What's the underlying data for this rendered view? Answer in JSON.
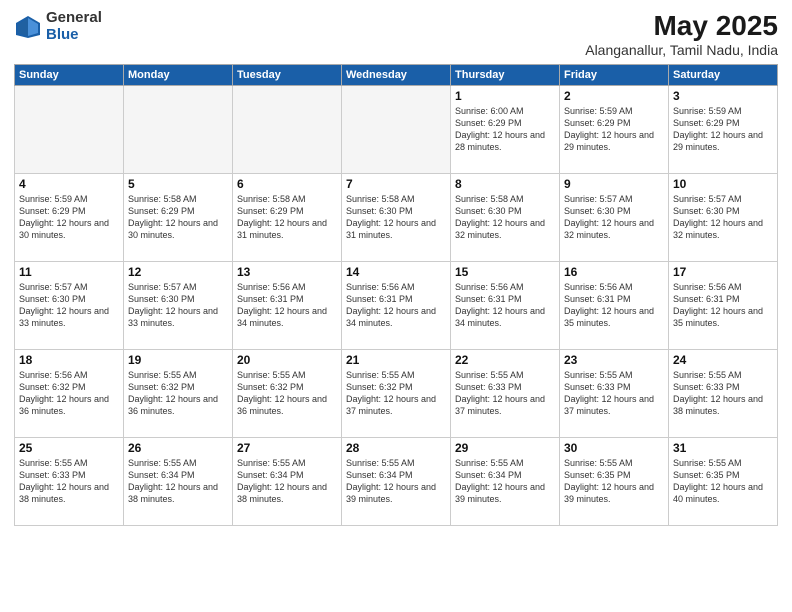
{
  "logo": {
    "general": "General",
    "blue": "Blue"
  },
  "title": "May 2025",
  "subtitle": "Alanganallur, Tamil Nadu, India",
  "days_of_week": [
    "Sunday",
    "Monday",
    "Tuesday",
    "Wednesday",
    "Thursday",
    "Friday",
    "Saturday"
  ],
  "weeks": [
    [
      {
        "day": "",
        "empty": true
      },
      {
        "day": "",
        "empty": true
      },
      {
        "day": "",
        "empty": true
      },
      {
        "day": "",
        "empty": true
      },
      {
        "day": "1",
        "sunrise": "6:00 AM",
        "sunset": "6:29 PM",
        "daylight": "12 hours and 28 minutes."
      },
      {
        "day": "2",
        "sunrise": "5:59 AM",
        "sunset": "6:29 PM",
        "daylight": "12 hours and 29 minutes."
      },
      {
        "day": "3",
        "sunrise": "5:59 AM",
        "sunset": "6:29 PM",
        "daylight": "12 hours and 29 minutes."
      }
    ],
    [
      {
        "day": "4",
        "sunrise": "5:59 AM",
        "sunset": "6:29 PM",
        "daylight": "12 hours and 30 minutes."
      },
      {
        "day": "5",
        "sunrise": "5:58 AM",
        "sunset": "6:29 PM",
        "daylight": "12 hours and 30 minutes."
      },
      {
        "day": "6",
        "sunrise": "5:58 AM",
        "sunset": "6:29 PM",
        "daylight": "12 hours and 31 minutes."
      },
      {
        "day": "7",
        "sunrise": "5:58 AM",
        "sunset": "6:30 PM",
        "daylight": "12 hours and 31 minutes."
      },
      {
        "day": "8",
        "sunrise": "5:58 AM",
        "sunset": "6:30 PM",
        "daylight": "12 hours and 32 minutes."
      },
      {
        "day": "9",
        "sunrise": "5:57 AM",
        "sunset": "6:30 PM",
        "daylight": "12 hours and 32 minutes."
      },
      {
        "day": "10",
        "sunrise": "5:57 AM",
        "sunset": "6:30 PM",
        "daylight": "12 hours and 32 minutes."
      }
    ],
    [
      {
        "day": "11",
        "sunrise": "5:57 AM",
        "sunset": "6:30 PM",
        "daylight": "12 hours and 33 minutes."
      },
      {
        "day": "12",
        "sunrise": "5:57 AM",
        "sunset": "6:30 PM",
        "daylight": "12 hours and 33 minutes."
      },
      {
        "day": "13",
        "sunrise": "5:56 AM",
        "sunset": "6:31 PM",
        "daylight": "12 hours and 34 minutes."
      },
      {
        "day": "14",
        "sunrise": "5:56 AM",
        "sunset": "6:31 PM",
        "daylight": "12 hours and 34 minutes."
      },
      {
        "day": "15",
        "sunrise": "5:56 AM",
        "sunset": "6:31 PM",
        "daylight": "12 hours and 34 minutes."
      },
      {
        "day": "16",
        "sunrise": "5:56 AM",
        "sunset": "6:31 PM",
        "daylight": "12 hours and 35 minutes."
      },
      {
        "day": "17",
        "sunrise": "5:56 AM",
        "sunset": "6:31 PM",
        "daylight": "12 hours and 35 minutes."
      }
    ],
    [
      {
        "day": "18",
        "sunrise": "5:56 AM",
        "sunset": "6:32 PM",
        "daylight": "12 hours and 36 minutes."
      },
      {
        "day": "19",
        "sunrise": "5:55 AM",
        "sunset": "6:32 PM",
        "daylight": "12 hours and 36 minutes."
      },
      {
        "day": "20",
        "sunrise": "5:55 AM",
        "sunset": "6:32 PM",
        "daylight": "12 hours and 36 minutes."
      },
      {
        "day": "21",
        "sunrise": "5:55 AM",
        "sunset": "6:32 PM",
        "daylight": "12 hours and 37 minutes."
      },
      {
        "day": "22",
        "sunrise": "5:55 AM",
        "sunset": "6:33 PM",
        "daylight": "12 hours and 37 minutes."
      },
      {
        "day": "23",
        "sunrise": "5:55 AM",
        "sunset": "6:33 PM",
        "daylight": "12 hours and 37 minutes."
      },
      {
        "day": "24",
        "sunrise": "5:55 AM",
        "sunset": "6:33 PM",
        "daylight": "12 hours and 38 minutes."
      }
    ],
    [
      {
        "day": "25",
        "sunrise": "5:55 AM",
        "sunset": "6:33 PM",
        "daylight": "12 hours and 38 minutes."
      },
      {
        "day": "26",
        "sunrise": "5:55 AM",
        "sunset": "6:34 PM",
        "daylight": "12 hours and 38 minutes."
      },
      {
        "day": "27",
        "sunrise": "5:55 AM",
        "sunset": "6:34 PM",
        "daylight": "12 hours and 38 minutes."
      },
      {
        "day": "28",
        "sunrise": "5:55 AM",
        "sunset": "6:34 PM",
        "daylight": "12 hours and 39 minutes."
      },
      {
        "day": "29",
        "sunrise": "5:55 AM",
        "sunset": "6:34 PM",
        "daylight": "12 hours and 39 minutes."
      },
      {
        "day": "30",
        "sunrise": "5:55 AM",
        "sunset": "6:35 PM",
        "daylight": "12 hours and 39 minutes."
      },
      {
        "day": "31",
        "sunrise": "5:55 AM",
        "sunset": "6:35 PM",
        "daylight": "12 hours and 40 minutes."
      }
    ]
  ]
}
